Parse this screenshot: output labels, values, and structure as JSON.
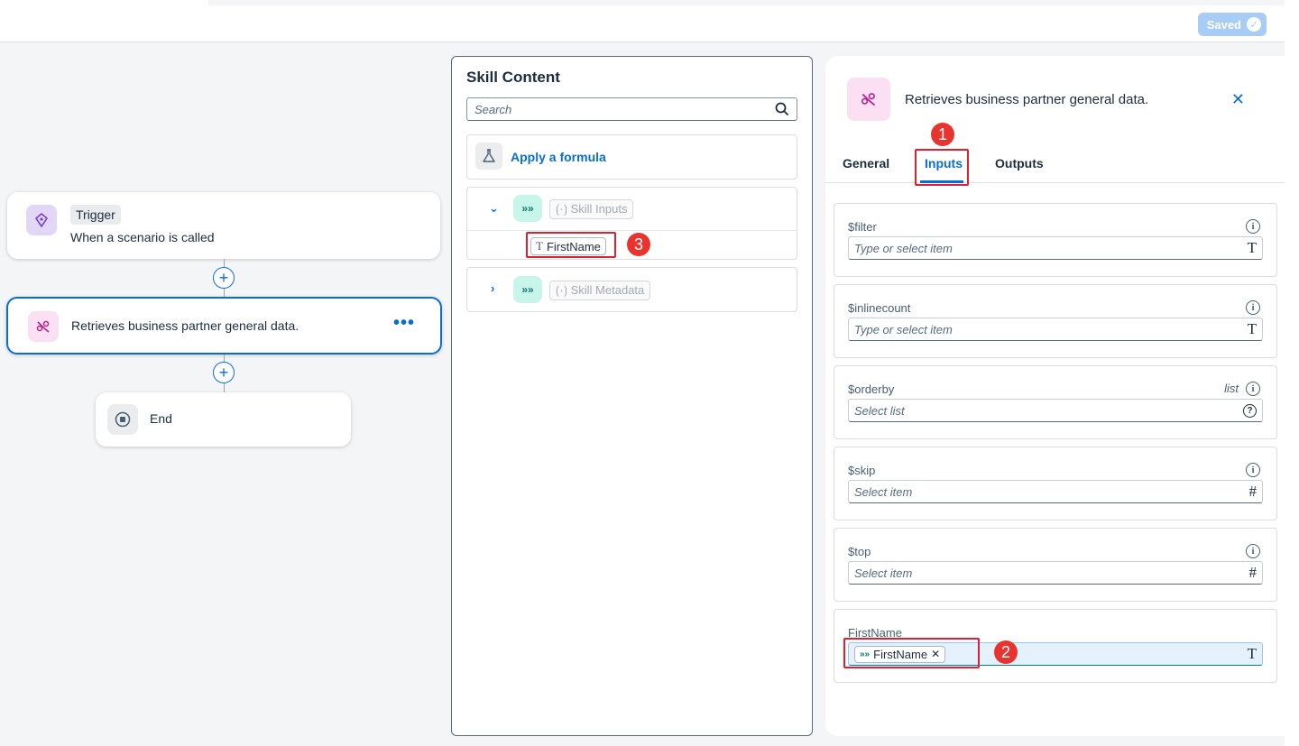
{
  "topbar": {
    "saved_label": "Saved"
  },
  "canvas": {
    "trigger": {
      "tag": "Trigger",
      "subtitle": "When a scenario is called"
    },
    "step": {
      "label": "Retrieves business partner general data.",
      "more": "•••"
    },
    "end": {
      "label": "End"
    },
    "add_symbol": "+"
  },
  "skill_content": {
    "title": "Skill Content",
    "search_placeholder": "Search",
    "formula_label": "Apply a formula",
    "skill_inputs_label": "Skill Inputs",
    "firstname_chip": "FirstName",
    "skill_metadata_label": "Skill Metadata",
    "badge": "3"
  },
  "details_panel": {
    "title": "Retrieves business partner general data.",
    "tabs": [
      "General",
      "Inputs",
      "Outputs"
    ],
    "active_tab": "Inputs",
    "tab_badge": "1",
    "fields": [
      {
        "label": "$filter",
        "placeholder": "Type or select item",
        "type_icon": "T"
      },
      {
        "label": "$inlinecount",
        "placeholder": "Type or select item",
        "type_icon": "T"
      },
      {
        "label": "$orderby",
        "placeholder": "Select list",
        "type_icon": "?",
        "hint": "list"
      },
      {
        "label": "$skip",
        "placeholder": "Select item",
        "type_icon": "#"
      },
      {
        "label": "$top",
        "placeholder": "Select item",
        "type_icon": "#"
      },
      {
        "label": "FirstName",
        "token": "FirstName",
        "type_icon": "T"
      }
    ],
    "field_badge": "2"
  }
}
